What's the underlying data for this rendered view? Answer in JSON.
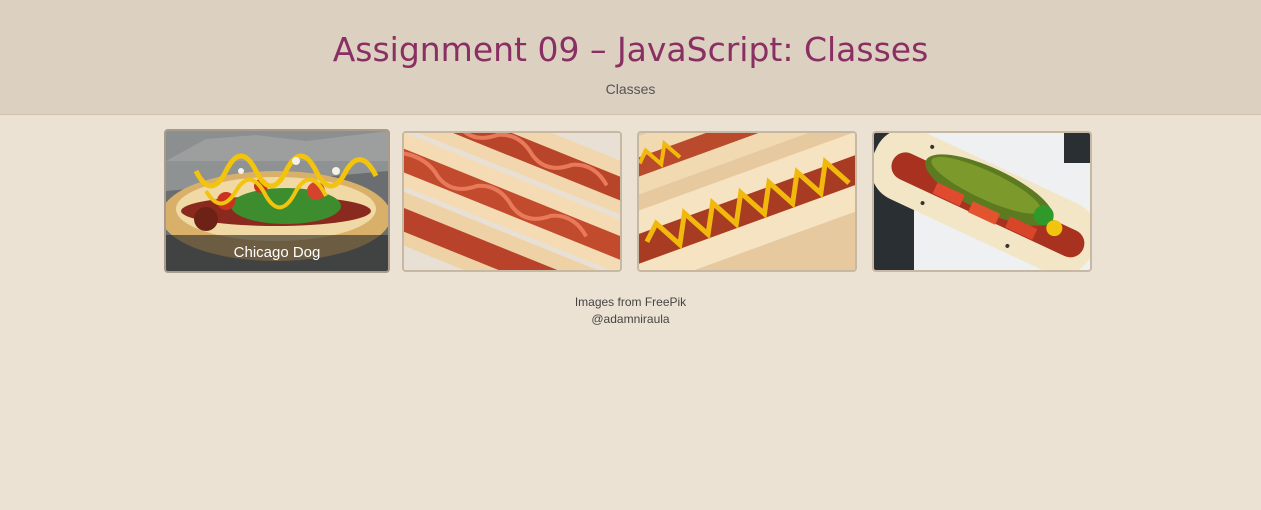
{
  "header": {
    "title": "Assignment 09 – JavaScript: Classes",
    "subtitle": "Classes"
  },
  "gallery": {
    "items": [
      {
        "caption": "Chicago Dog",
        "image": "chicago-dog-photo",
        "selected": true
      },
      {
        "caption": "",
        "image": "bacon-dog-photo",
        "selected": false
      },
      {
        "caption": "",
        "image": "mustard-dog-photo",
        "selected": false
      },
      {
        "caption": "",
        "image": "pickle-dog-photo",
        "selected": false
      }
    ]
  },
  "footer": {
    "credit": "Images from FreePik",
    "handle": "@adamniraula"
  },
  "colors": {
    "header_bg": "#dcd0c0",
    "page_bg": "#ece2d3",
    "title": "#8a2f63"
  }
}
